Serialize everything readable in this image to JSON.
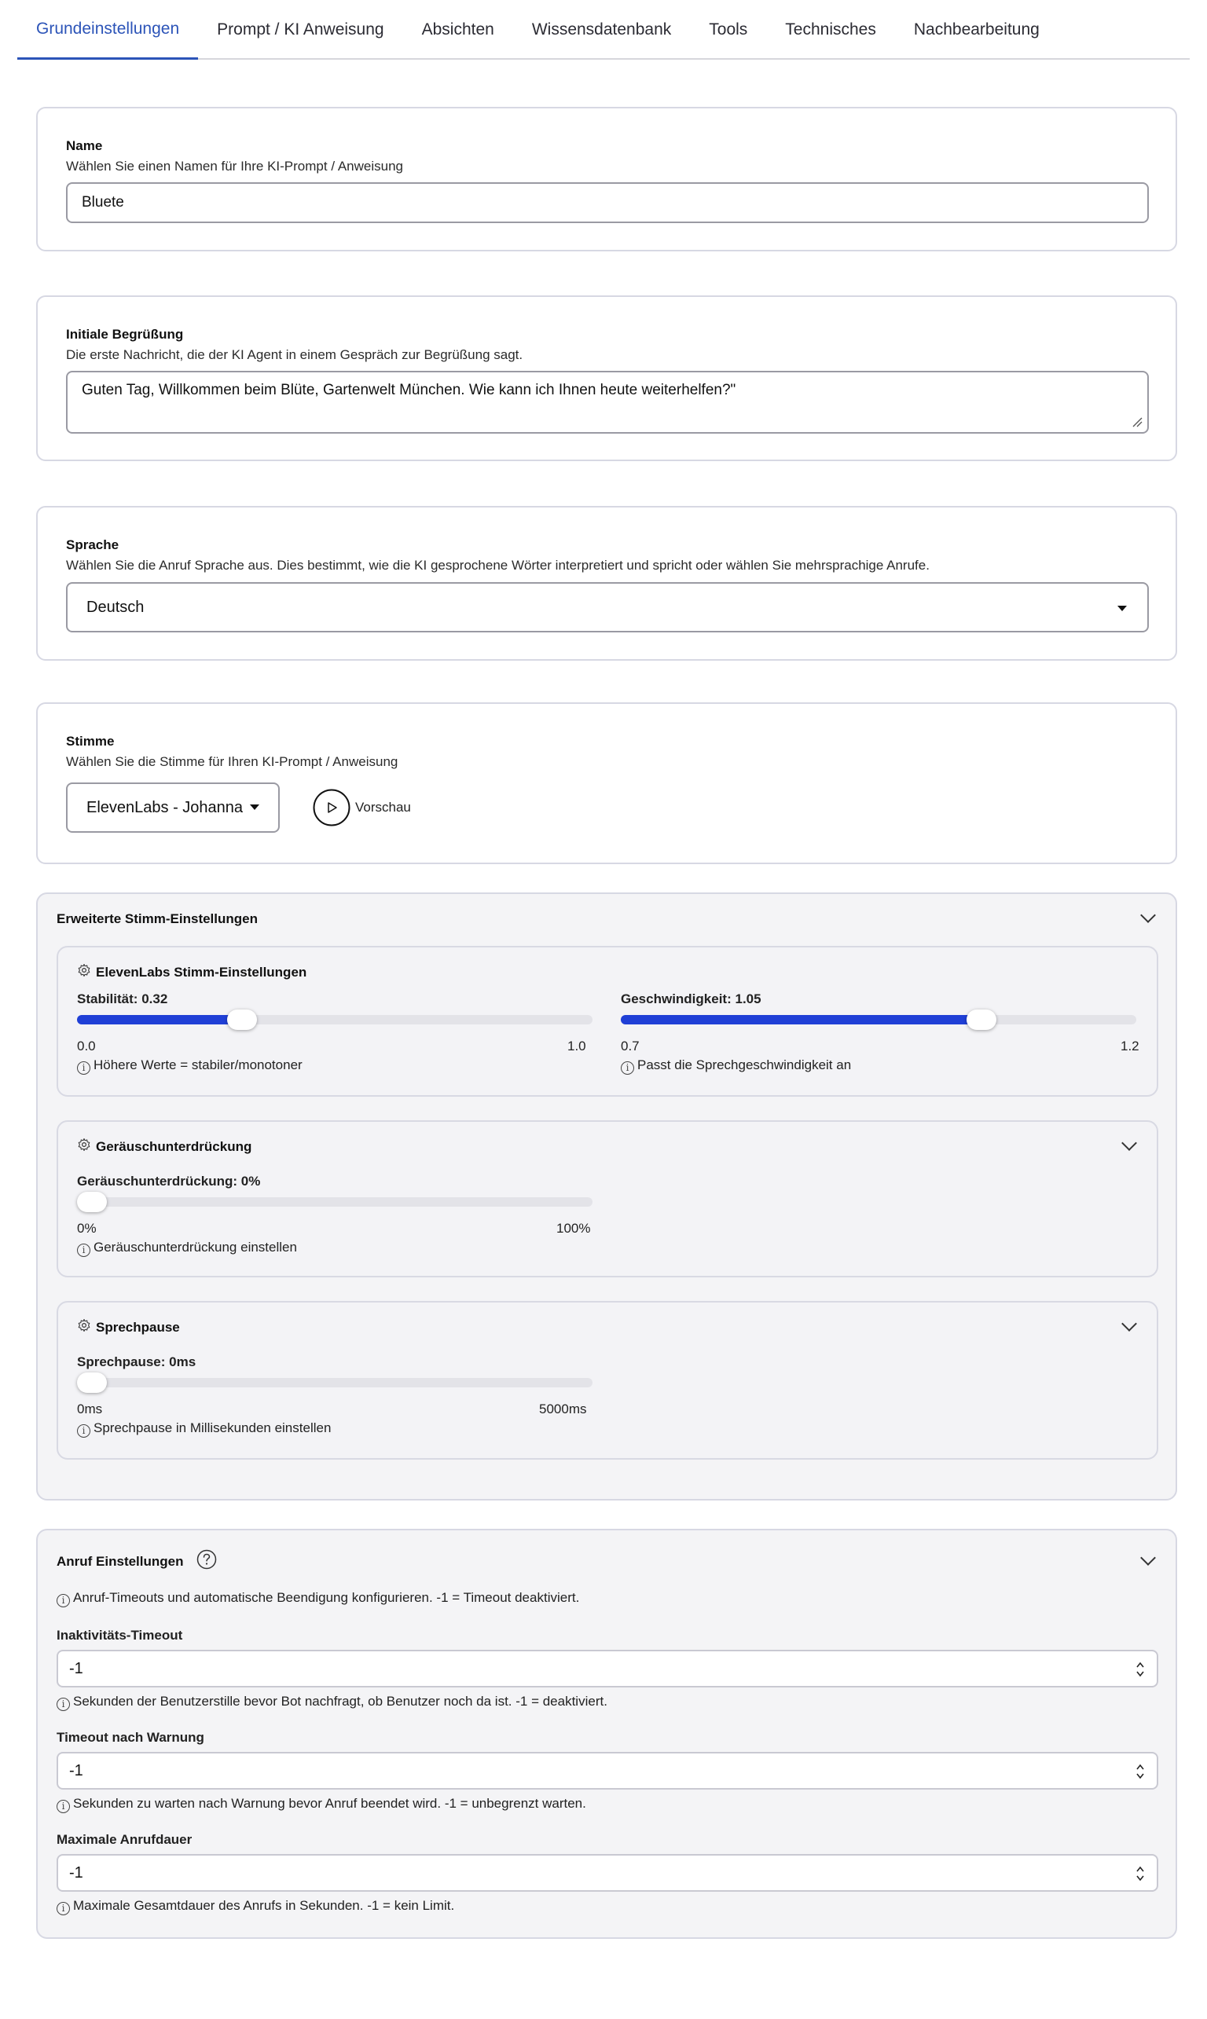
{
  "tabs": [
    "Grundeinstellungen",
    "Prompt / KI Anweisung",
    "Absichten",
    "Wissensdatenbank",
    "Tools",
    "Technisches",
    "Nachbearbeitung"
  ],
  "name": {
    "title": "Name",
    "desc": "Wählen Sie einen Namen für Ihre KI-Prompt / Anweisung",
    "value": "Bluete"
  },
  "greeting": {
    "title": "Initiale Begrüßung",
    "desc": "Die erste Nachricht, die der KI Agent in einem Gespräch zur Begrüßung sagt.",
    "value": "Guten Tag, Willkommen beim Blüte, Gartenwelt München. Wie kann ich Ihnen heute weiterhelfen?\""
  },
  "language": {
    "title": "Sprache",
    "desc": "Wählen Sie die Anruf Sprache aus. Dies bestimmt, wie die KI gesprochene Wörter interpretiert und spricht oder wählen Sie mehrsprachige Anrufe.",
    "value": "Deutsch"
  },
  "voice": {
    "title": "Stimme",
    "desc": "Wählen Sie die Stimme für Ihren KI-Prompt / Anweisung",
    "value": "ElevenLabs - Johanna",
    "preview_label": "Vorschau"
  },
  "advanced": {
    "title": "Erweiterte Stimm-Einstellungen",
    "elevenlabs": {
      "title": "ElevenLabs Stimm-Einstellungen",
      "stability": {
        "label": "Stabilität:",
        "value": "0.32",
        "min": "0.0",
        "max": "1.0",
        "fraction": 0.32,
        "hint": "Höhere Werte = stabiler/monotoner"
      },
      "speed": {
        "label": "Geschwindigkeit:",
        "value": "1.05",
        "min": "0.7",
        "max": "1.2",
        "fraction": 0.7,
        "hint": "Passt die Sprechgeschwindigkeit an"
      }
    },
    "noise": {
      "title": "Geräuschunterdrückung",
      "label": "Geräuschunterdrückung:",
      "value": "0%",
      "min": "0%",
      "max": "100%",
      "fraction": 0,
      "hint": "Geräuschunterdrückung einstellen"
    },
    "pause": {
      "title": "Sprechpause",
      "label": "Sprechpause:",
      "value": "0ms",
      "min": "0ms",
      "max": "5000ms",
      "fraction": 0,
      "hint": "Sprechpause in Millisekunden einstellen"
    }
  },
  "call": {
    "title": "Anruf Einstellungen",
    "info": "Anruf-Timeouts und automatische Beendigung konfigurieren. -1 = Timeout deaktiviert.",
    "inactivity": {
      "label": "Inaktivitäts-Timeout",
      "value": "-1",
      "hint": "Sekunden der Benutzerstille bevor Bot nachfragt, ob Benutzer noch da ist. -1 = deaktiviert."
    },
    "warning": {
      "label": "Timeout nach Warnung",
      "value": "-1",
      "hint": "Sekunden zu warten nach Warnung bevor Anruf beendet wird. -1 = unbegrenzt warten."
    },
    "max": {
      "label": "Maximale Anrufdauer",
      "value": "-1",
      "hint": "Maximale Gesamtdauer des Anrufs in Sekunden. -1 = kein Limit."
    }
  },
  "colors": {
    "accent": "#2c54b8",
    "slider": "#1f3fd6",
    "border": "#d7d8e3",
    "panel_bg": "#f4f4f6"
  }
}
